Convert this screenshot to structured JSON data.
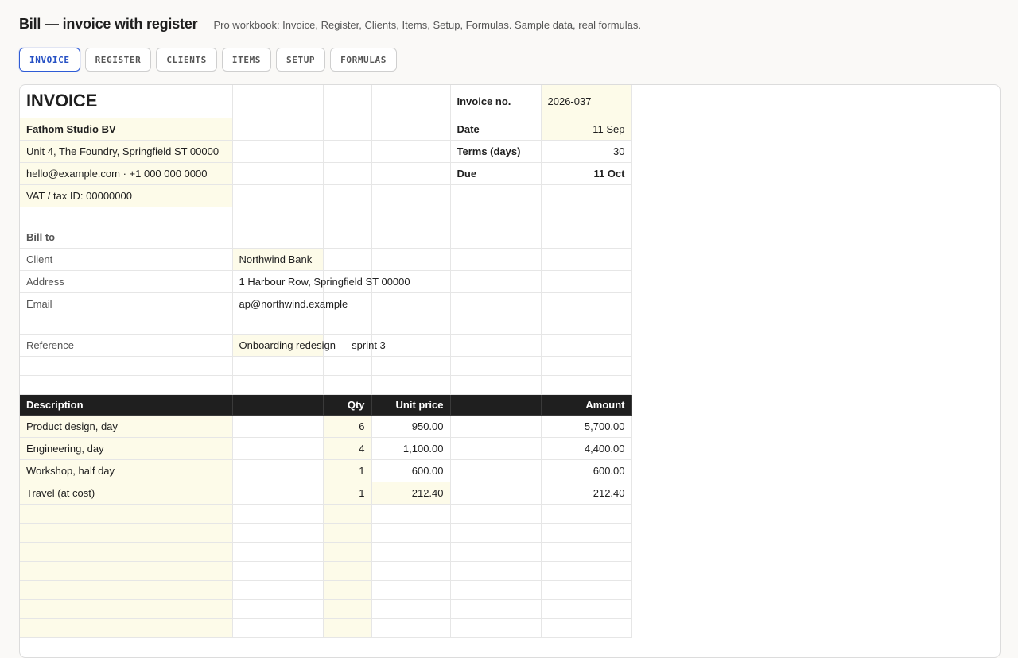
{
  "app": {
    "title": "Bill — invoice with register",
    "subtitle": "Pro workbook: Invoice, Register, Clients, Items, Setup, Formulas. Sample data, real formulas."
  },
  "tabs": [
    "INVOICE",
    "REGISTER",
    "CLIENTS",
    "ITEMS",
    "SETUP",
    "FORMULAS"
  ],
  "invoice": {
    "heading": "INVOICE",
    "seller": {
      "name": "Fathom Studio BV",
      "address": "Unit 4, The Foundry, Springfield ST 00000",
      "contact": "hello@example.com · +1 000 000 0000",
      "tax_id": "VAT / tax ID: 00000000"
    },
    "meta": {
      "invoice_no_label": "Invoice no.",
      "invoice_no": "2026-037",
      "date_label": "Date",
      "date": "11 Sep",
      "terms_label": "Terms (days)",
      "terms": "30",
      "due_label": "Due",
      "due": "11 Oct"
    },
    "bill_to": {
      "heading": "Bill to",
      "client_label": "Client",
      "client": "Northwind Bank",
      "address_label": "Address",
      "address": "1 Harbour Row, Springfield ST 00000",
      "email_label": "Email",
      "email": "ap@northwind.example"
    },
    "reference_label": "Reference",
    "reference": "Onboarding redesign — sprint 3",
    "table": {
      "headers": {
        "description": "Description",
        "qty": "Qty",
        "unit_price": "Unit price",
        "amount": "Amount"
      },
      "rows": [
        {
          "description": "Product design, day",
          "qty": "6",
          "unit_price": "950.00",
          "amount": "5,700.00"
        },
        {
          "description": "Engineering, day",
          "qty": "4",
          "unit_price": "1,100.00",
          "amount": "4,400.00"
        },
        {
          "description": "Workshop, half day",
          "qty": "1",
          "unit_price": "600.00",
          "amount": "600.00"
        },
        {
          "description": "Travel (at cost)",
          "qty": "1",
          "unit_price": "212.40",
          "amount": "212.40"
        }
      ]
    }
  }
}
